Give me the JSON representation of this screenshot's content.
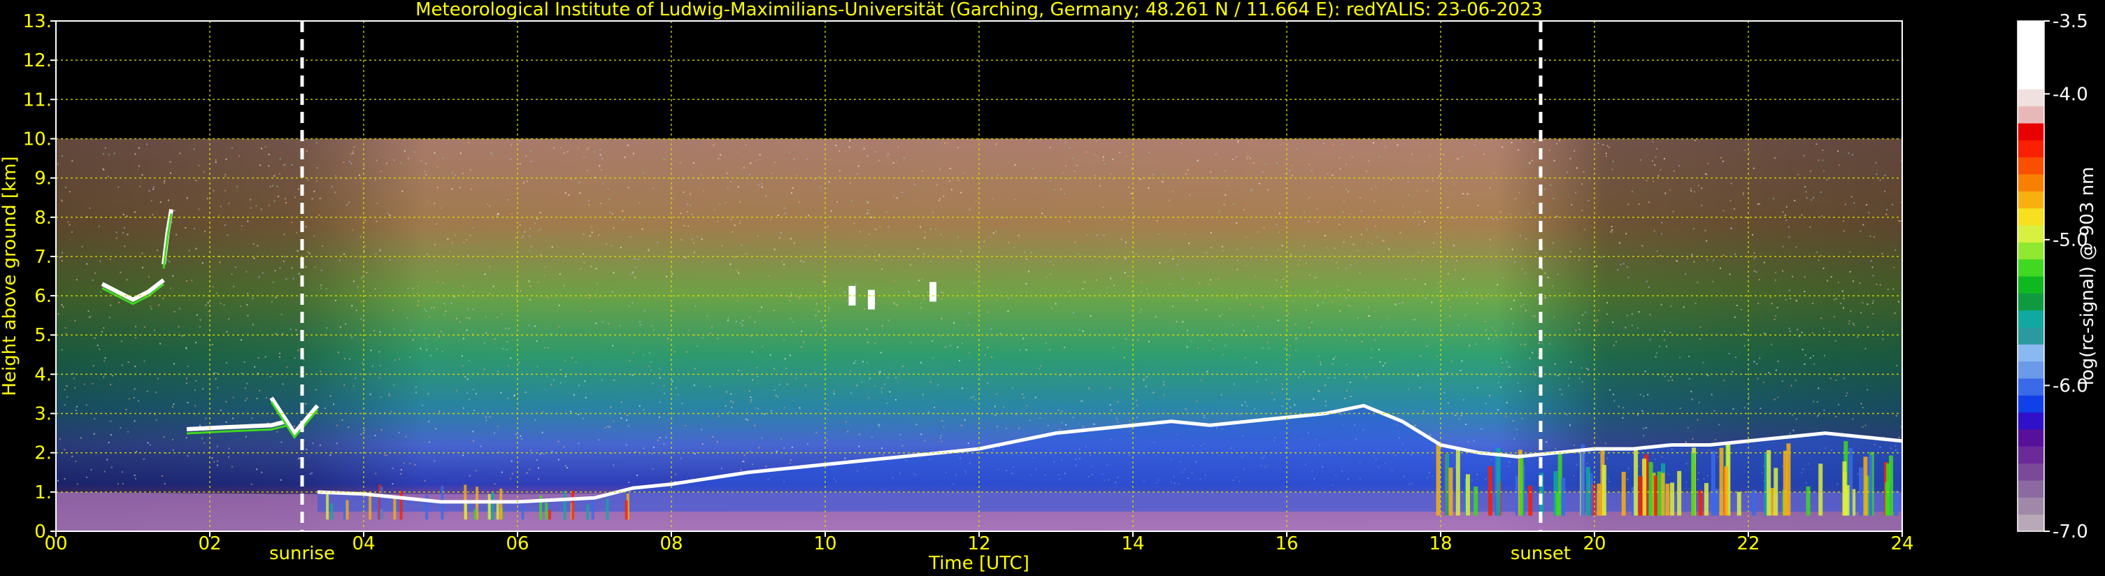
{
  "chart_data": {
    "type": "heatmap",
    "title": "Meteorological Institute of Ludwig-Maximilians-Universität (Garching, Germany; 48.261 N / 11.664 E):    redYALIS: 23-06-2023",
    "xlabel": "Time [UTC]",
    "ylabel": "Height above ground [km]",
    "colorbar_label": "log(rc-signal) @ 903 nm",
    "xlim": [
      0,
      24
    ],
    "ylim": [
      0,
      13
    ],
    "x_ticks": [
      "00",
      "02",
      "04",
      "06",
      "08",
      "10",
      "12",
      "14",
      "16",
      "18",
      "20",
      "22",
      "24"
    ],
    "y_ticks": [
      "0.",
      "1.",
      "2.",
      "3.",
      "4.",
      "5.",
      "6.",
      "7.",
      "8.",
      "9.",
      "10.",
      "11.",
      "12.",
      "13."
    ],
    "colorbar_range": [
      -7.0,
      -3.5
    ],
    "colorbar_ticks": [
      "-3.5",
      "-4.0",
      "-5.0",
      "-6.0",
      "-7.0"
    ],
    "colorbar_colors": [
      "#b8a8b8",
      "#a088a8",
      "#8a6aa0",
      "#7a4a98",
      "#6a2a98",
      "#58109a",
      "#3010c8",
      "#1040e8",
      "#3a6ae8",
      "#6a9ae8",
      "#8ab8f0",
      "#2a9aa0",
      "#10a8a0",
      "#109a40",
      "#10b820",
      "#40d820",
      "#90e830",
      "#d8f040",
      "#f8e020",
      "#f8b010",
      "#f88000",
      "#f85000",
      "#f82000",
      "#e80000",
      "#e8b8b8",
      "#f0e0e0",
      "#ffffff",
      "#ffffff",
      "#ffffff",
      "#ffffff"
    ],
    "grid": true,
    "grid_color": "#d8d800",
    "text_color": "#ffff00",
    "markers": [
      {
        "label": "sunrise",
        "x": 3.2
      },
      {
        "label": "sunset",
        "x": 19.3
      }
    ],
    "data_top_km": 10.0,
    "features": {
      "aerosol_layer_top": {
        "x": [
          3.4,
          4,
          5,
          6,
          7,
          7.5,
          8,
          8.5,
          9,
          9.5,
          10,
          10.5,
          11,
          11.5,
          12,
          12.5,
          13,
          13.5,
          14,
          14.5,
          15,
          15.5,
          16,
          16.5,
          17,
          17.5,
          18,
          18.5,
          19,
          19.5,
          20,
          20.5,
          21,
          21.5,
          22,
          22.5,
          23,
          23.5,
          24
        ],
        "y": [
          1.0,
          0.95,
          0.75,
          0.75,
          0.85,
          1.1,
          1.2,
          1.35,
          1.5,
          1.6,
          1.7,
          1.8,
          1.9,
          2.0,
          2.1,
          2.3,
          2.5,
          2.6,
          2.7,
          2.8,
          2.7,
          2.8,
          2.9,
          3.0,
          3.2,
          2.8,
          2.2,
          2.0,
          1.9,
          2.0,
          2.1,
          2.1,
          2.2,
          2.2,
          2.3,
          2.4,
          2.5,
          2.4,
          2.3
        ]
      },
      "boundary_layer": {
        "x": [
          0,
          3,
          6,
          9,
          12,
          15,
          18,
          21,
          24
        ],
        "y": [
          1.0,
          0.95,
          0.95,
          1.0,
          1.0,
          1.0,
          1.0,
          1.0,
          1.0
        ]
      },
      "cloud_layers": [
        {
          "x": [
            0.6,
            0.8,
            1.0,
            1.2,
            1.4
          ],
          "y": [
            6.3,
            6.1,
            5.9,
            6.1,
            6.4
          ]
        },
        {
          "x": [
            1.4,
            1.45,
            1.5
          ],
          "y": [
            6.8,
            7.6,
            8.2
          ]
        },
        {
          "x": [
            1.7,
            2.2,
            2.8,
            3.0
          ],
          "y": [
            2.6,
            2.65,
            2.7,
            2.8
          ]
        },
        {
          "x": [
            2.8,
            3.1,
            3.4
          ],
          "y": [
            3.4,
            2.5,
            3.2
          ]
        }
      ],
      "cirrus_spots": [
        {
          "x": 10.35,
          "y": 6.0
        },
        {
          "x": 10.6,
          "y": 5.9
        },
        {
          "x": 11.4,
          "y": 6.1
        }
      ]
    }
  }
}
